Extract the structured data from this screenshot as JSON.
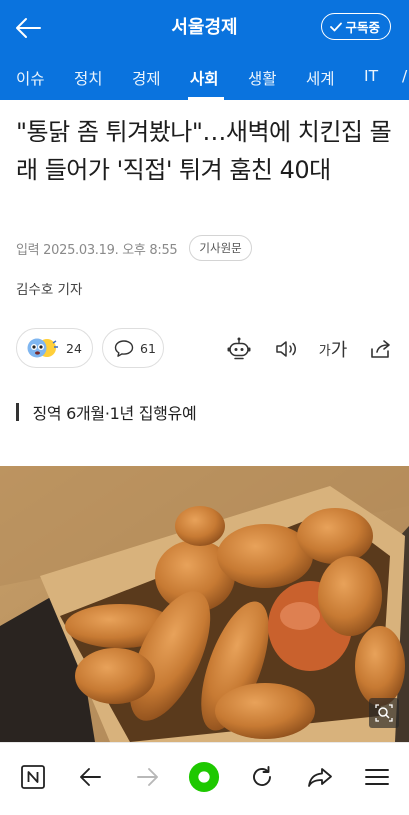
{
  "header": {
    "site_title": "서울경제",
    "subscribe_label": "구독중",
    "back_icon": "arrow-left-icon",
    "subscribe_icon": "check-icon",
    "color": "#0a73de"
  },
  "nav": {
    "tabs": [
      {
        "label": "이슈",
        "active": false
      },
      {
        "label": "정치",
        "active": false
      },
      {
        "label": "경제",
        "active": false
      },
      {
        "label": "사회",
        "active": true
      },
      {
        "label": "생활",
        "active": false
      },
      {
        "label": "세계",
        "active": false
      },
      {
        "label": "IT",
        "active": false
      }
    ]
  },
  "article": {
    "headline": "\"통닭 좀 튀겨봤나\"…새벽에 치킨집 몰래 들어가 '직접' 튀겨 훔친 40대",
    "date": "입력 2025.03.19. 오후 8:55",
    "original_label": "기사원문",
    "reporter": "김수호 기자",
    "subheadline": "징역 6개월·1년 집행유예",
    "photo_alt": "fried chicken in a takeout box"
  },
  "actions": {
    "reaction_count": "24",
    "comment_count": "61",
    "reaction_icon": "emoji-reaction-icon",
    "comment_icon": "speech-bubble-icon",
    "robot_icon": "robot-summary-icon",
    "speaker_icon": "speaker-icon",
    "font_small": "가",
    "font_large": "가",
    "share_icon": "share-icon"
  },
  "bottom_bar": {
    "icons": [
      "naver-n-icon",
      "back-arrow-icon",
      "forward-arrow-icon",
      "home-green-circle-icon",
      "refresh-icon",
      "share-arrow-icon",
      "menu-icon"
    ],
    "home_color": "#1ec800"
  }
}
